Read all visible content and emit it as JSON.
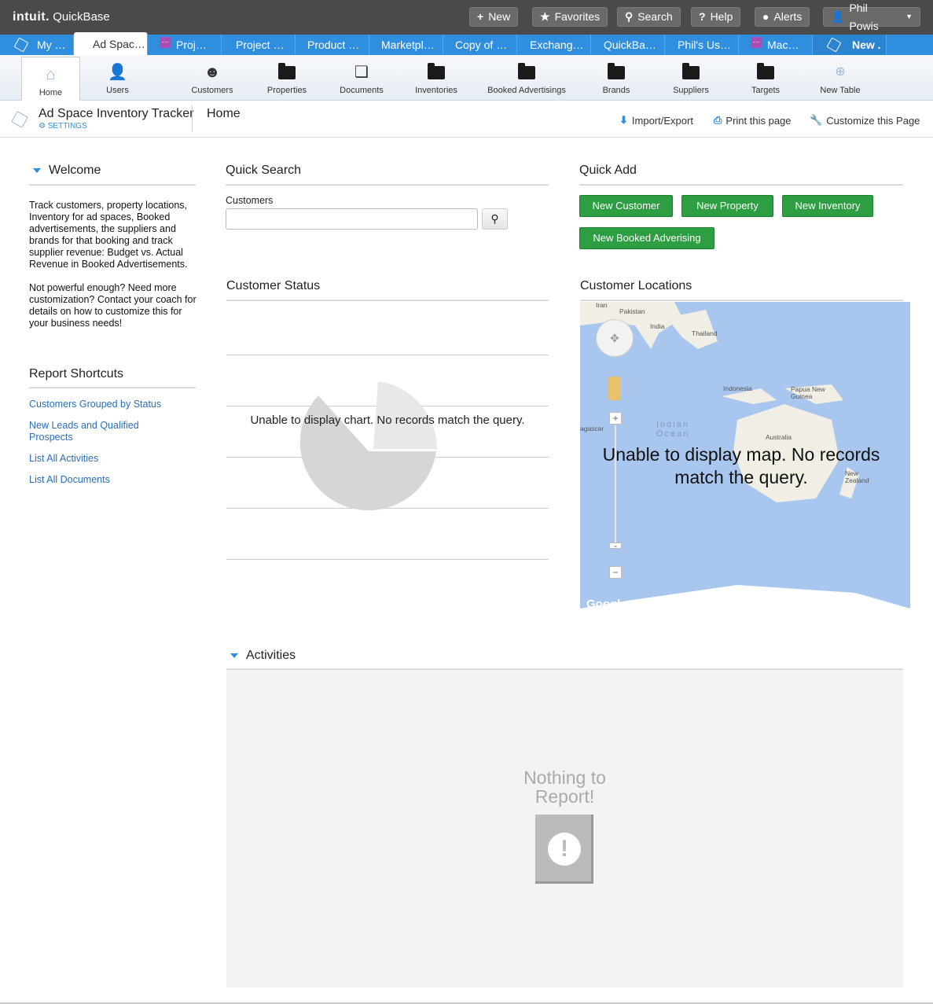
{
  "topbar": {
    "logo_brand": "intuit.",
    "logo_product": "QuickBase",
    "buttons": {
      "new": "New",
      "favorites": "Favorites",
      "search": "Search",
      "help": "Help",
      "alerts": "Alerts",
      "user": "Phil Powis"
    }
  },
  "tabs": [
    "My …",
    "Ad Spac…",
    "Proj…",
    "Project …",
    "Product …",
    "Marketpl…",
    "Copy of …",
    "Exchang…",
    "QuickBa…",
    "Phil's Us…",
    "Mac…",
    "New ."
  ],
  "toolbar": {
    "items": [
      "Home",
      "Users",
      "Customers",
      "Properties",
      "Documents",
      "Inventories",
      "Booked Advertisings",
      "Brands",
      "Suppliers",
      "Targets",
      "New Table"
    ]
  },
  "breadcrumb": {
    "app_title": "Ad Space Inventory Tracker",
    "settings": "SETTINGS",
    "page": "Home",
    "import_export": "Import/Export",
    "print": "Print this page",
    "customize": "Customize this Page"
  },
  "welcome": {
    "title": "Welcome",
    "text1": "Track customers, property  locations, Inventory for ad spaces, Booked advertisements, the suppliers and brands for that booking and track supplier revenue: Budget vs. Actual Revenue in Booked Advertisements.",
    "text2": "Not powerful enough?  Need more customization?  Contact your coach for details on how to customize this for your business needs!"
  },
  "shortcuts": {
    "title": "Report Shortcuts",
    "links": [
      "Customers Grouped by Status",
      "New Leads and Qualified Prospects",
      "List All Activities",
      "List All Documents"
    ]
  },
  "quick_search": {
    "title": "Quick Search",
    "label": "Customers",
    "value": ""
  },
  "quick_add": {
    "title": "Quick Add",
    "buttons": [
      "New Customer",
      "New Property",
      "New Inventory",
      "New Booked Adverising"
    ]
  },
  "customer_status": {
    "title": "Customer Status",
    "message": "Unable to display chart. No records match the query."
  },
  "customer_locations": {
    "title": "Customer Locations",
    "message": "Unable to display map. No records match the query.",
    "map_labels": [
      "Iran",
      "Pakistan",
      "India",
      "Thailand",
      "Indonesia",
      "Papua New Guinea",
      "Indian Ocean",
      "Australia",
      "New Zealand",
      "agascar",
      "Google"
    ]
  },
  "activities": {
    "title": "Activities",
    "empty": "Nothing to Report!"
  },
  "colors": {
    "accent_blue": "#2f8fde",
    "green_button": "#2e9e43",
    "topbar": "#4a4a4a"
  }
}
